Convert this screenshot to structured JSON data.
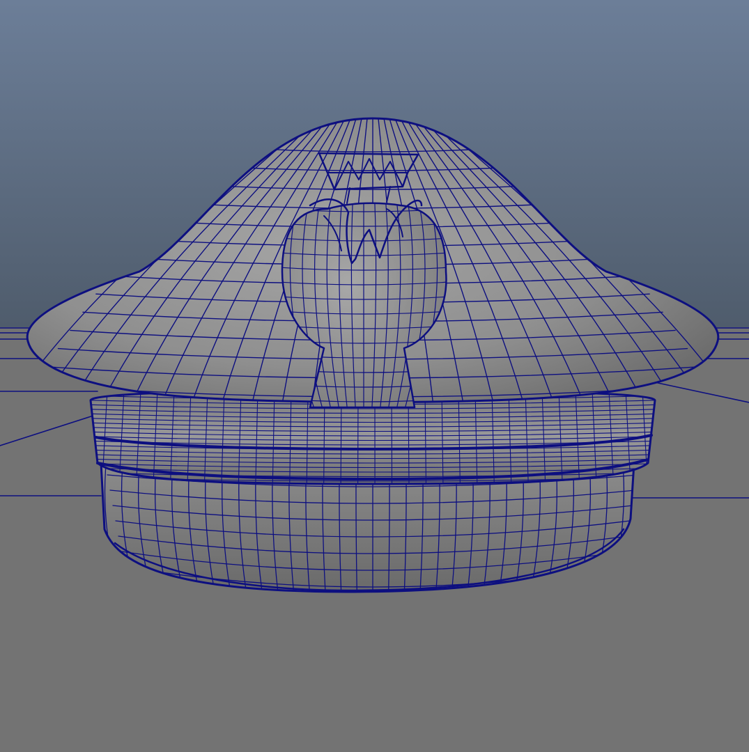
{
  "viewport": {
    "background_top_color": "#6c7e98",
    "background_horizon_color": "#4f5c6c",
    "ground_plane_color": "#737373",
    "wireframe_color": "#0d0f80",
    "mesh_shaded_color": "#8c8c8c",
    "mesh_highlight_color": "#a4a4a4",
    "mesh_shadow_color": "#5e5e5e"
  },
  "scene": {
    "object": "peaked-cap-mesh",
    "display_mode": "wireframe-on-shaded"
  }
}
